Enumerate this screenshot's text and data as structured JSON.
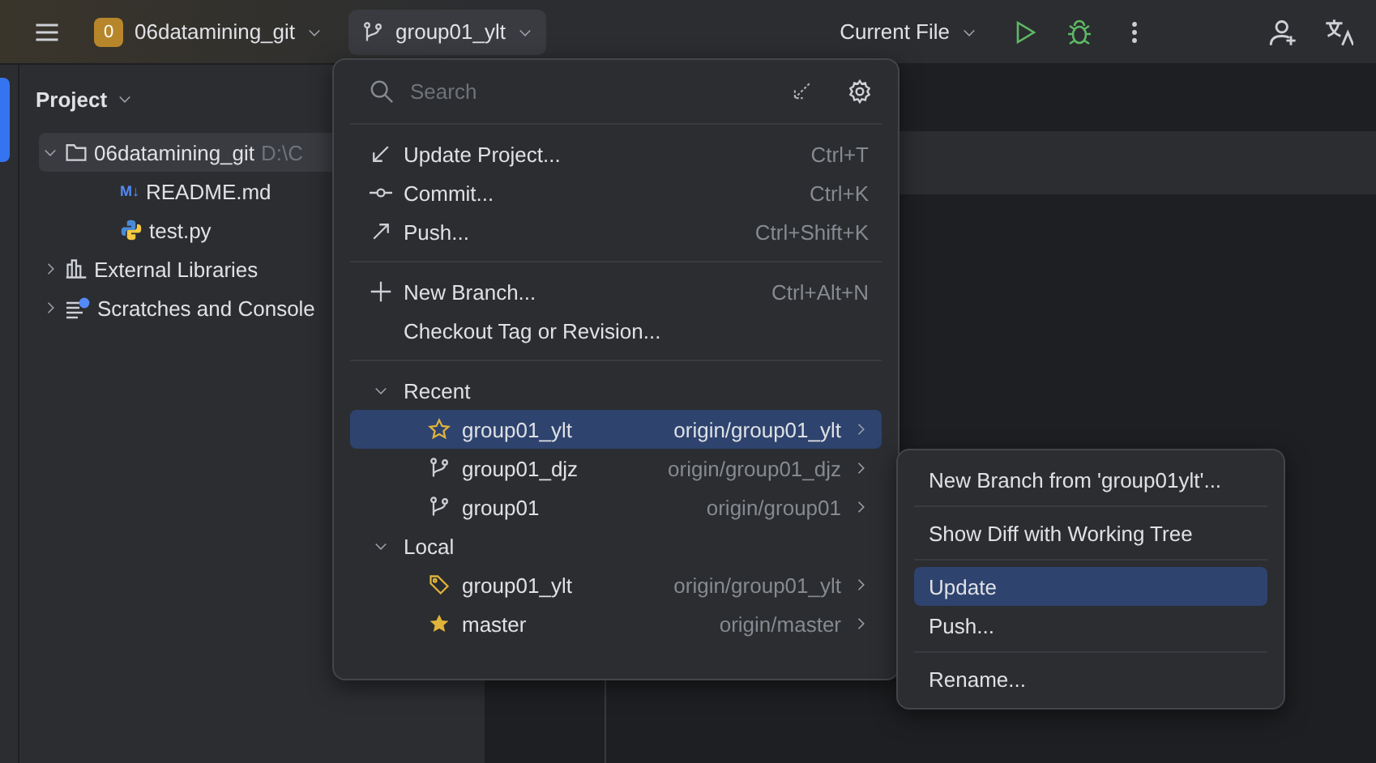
{
  "toolbar": {
    "project_badge": "0",
    "project_name": "06datamining_git",
    "branch": "group01_ylt",
    "run_config": "Current File"
  },
  "project_panel": {
    "title": "Project",
    "tree": [
      {
        "name": "06datamining_git",
        "path": "D:\\C",
        "kind": "folder",
        "expanded": true,
        "selected": true,
        "children": [
          {
            "name": "README.md",
            "kind": "markdown",
            "icon_text": "M↓",
            "selected": false
          },
          {
            "name": "test.py",
            "kind": "python",
            "selected": false
          }
        ]
      },
      {
        "name": "External Libraries",
        "kind": "libraries",
        "expanded": false,
        "selected": false
      },
      {
        "name": "Scratches and Console",
        "kind": "scratches",
        "expanded": false,
        "selected": false
      }
    ]
  },
  "branch_popup": {
    "search": {
      "placeholder": "Search"
    },
    "action_groups": [
      [
        {
          "label": "Update Project...",
          "shortcut": "Ctrl+T",
          "kind": "update"
        },
        {
          "label": "Commit...",
          "shortcut": "Ctrl+K",
          "kind": "commit"
        },
        {
          "label": "Push...",
          "shortcut": "Ctrl+Shift+K",
          "kind": "push"
        }
      ],
      [
        {
          "label": "New Branch...",
          "shortcut": "Ctrl+Alt+N",
          "kind": "new"
        },
        {
          "label": "Checkout Tag or Revision...",
          "kind": "none"
        }
      ]
    ],
    "sections": [
      {
        "title": "Recent",
        "expanded": true,
        "branches": [
          {
            "name": "group01_ylt",
            "remote": "origin/group01_ylt",
            "kind": "star",
            "selected": true
          },
          {
            "name": "group01_djz",
            "remote": "origin/group01_djz",
            "kind": "branch",
            "selected": false
          },
          {
            "name": "group01",
            "remote": "origin/group01",
            "kind": "branch",
            "selected": false
          }
        ]
      },
      {
        "title": "Local",
        "expanded": true,
        "branches": [
          {
            "name": "group01_ylt",
            "remote": "origin/group01_ylt",
            "kind": "tag",
            "selected": false
          },
          {
            "name": "master",
            "remote": "origin/master",
            "kind": "filled-star",
            "selected": false
          }
        ]
      }
    ]
  },
  "branch_submenu": {
    "groups": [
      [
        {
          "label": "New Branch from 'group01ylt'...",
          "selected": false
        }
      ],
      [
        {
          "label": "Show Diff with Working Tree",
          "selected": false
        }
      ],
      [
        {
          "label": "Update",
          "selected": true
        },
        {
          "label": "Push...",
          "selected": false
        }
      ],
      [
        {
          "label": "Rename...",
          "selected": false
        }
      ]
    ]
  }
}
